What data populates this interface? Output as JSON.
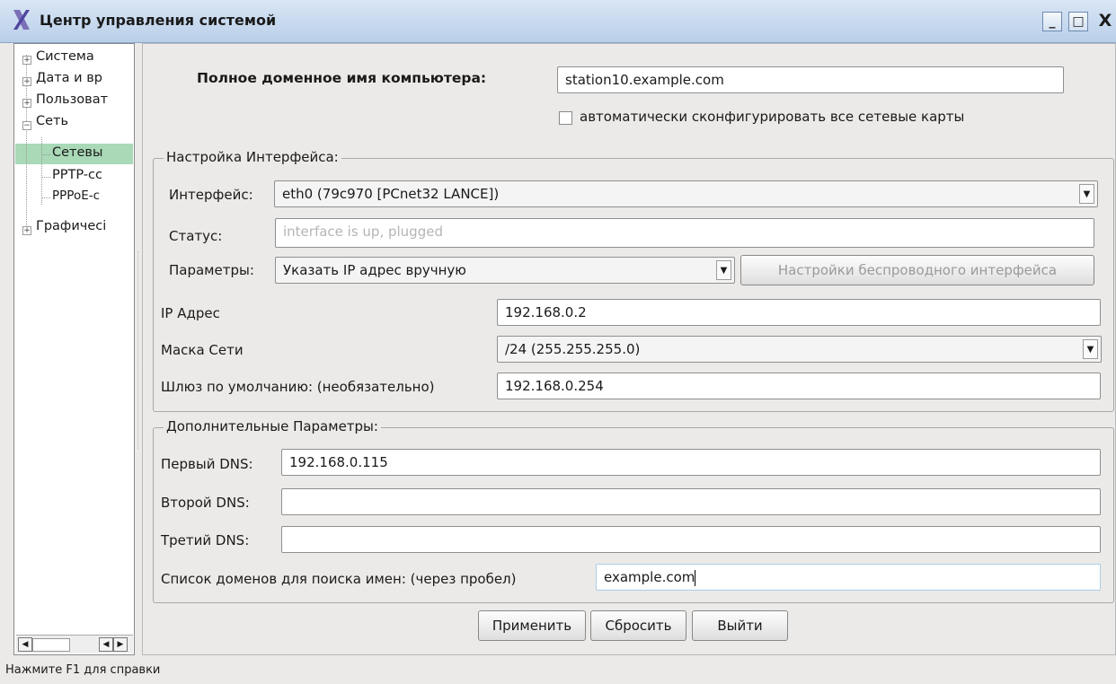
{
  "window": {
    "title": "Центр управления системой",
    "minimize_label": "_",
    "maximize_label": "□",
    "close_label": "X"
  },
  "tree": {
    "items": [
      {
        "label": "Система",
        "expander": "+"
      },
      {
        "label": "Дата и вр",
        "expander": "+"
      },
      {
        "label": "Пользоват",
        "expander": "+"
      },
      {
        "label": "Сеть",
        "expander": "−"
      },
      {
        "label": "Сетевы"
      },
      {
        "label": "PPTP-сс"
      },
      {
        "label": "PPPoE-с"
      },
      {
        "label": "Графичесі",
        "expander": "+"
      }
    ],
    "selected_index": 4,
    "selected_color": "#a9d9b7"
  },
  "hostname": {
    "label": "Полное доменное имя компьютера:",
    "value": "station10.example.com"
  },
  "auto_config": {
    "label": "автоматически сконфигурировать все сетевые карты",
    "checked": false
  },
  "interface_group": {
    "title": "Настройка Интерфейса:",
    "interface_label": "Интерфейс:",
    "interface_value": "eth0 (79c970 [PCnet32 LANCE])",
    "status_label": "Статус:",
    "status_placeholder": "interface is up, plugged",
    "params_label": "Параметры:",
    "params_value": "Указать IP адрес вручную",
    "wireless_button": "Настройки беспроводного интерфейса",
    "ip_label": "IP Адрес",
    "ip_value": "192.168.0.2",
    "mask_label": "Маска Сети",
    "mask_value": "/24 (255.255.255.0)",
    "gateway_label": "Шлюз по умолчанию: (необязательно)",
    "gateway_value": "192.168.0.254"
  },
  "extra_group": {
    "title": "Дополнительные Параметры:",
    "dns1_label": "Первый DNS:",
    "dns1_value": "192.168.0.115",
    "dns2_label": "Второй DNS:",
    "dns2_value": "",
    "dns3_label": "Третий DNS:",
    "dns3_value": "",
    "search_label": "Список доменов для поиска имен: (через пробел)",
    "search_value": "example.com"
  },
  "buttons": {
    "apply": "Применить",
    "reset": "Сбросить",
    "exit": "Выйти"
  },
  "statusbar": {
    "text": "Нажмите F1 для справки"
  },
  "icons": {
    "app": "x-logo-icon",
    "dropdown": "chevron-down-icon",
    "scroll_left": "arrow-left-icon",
    "scroll_right": "arrow-right-icon"
  }
}
